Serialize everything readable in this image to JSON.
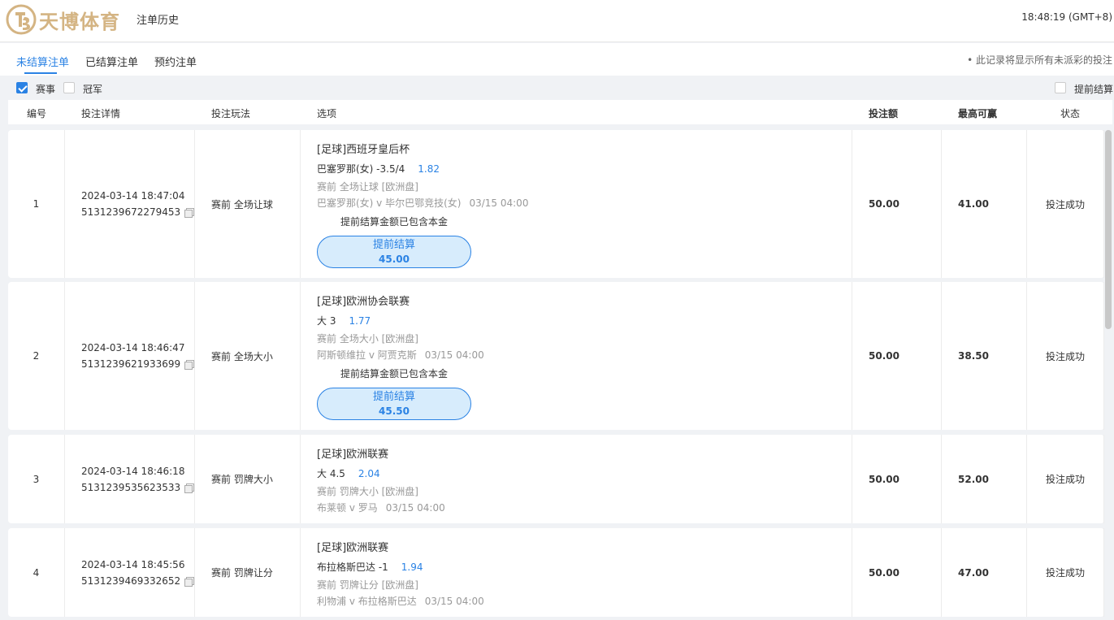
{
  "header": {
    "brand": "天博体育",
    "page_title": "注单历史",
    "clock": "18:48:19 (GMT+8)"
  },
  "tabs": [
    {
      "label": "未结算注单",
      "active": true
    },
    {
      "label": "已结算注单",
      "active": false
    },
    {
      "label": "预约注单",
      "active": false
    }
  ],
  "tab_note": "• 此记录将显示所有未派彩的投注",
  "filters": {
    "match_label": "赛事",
    "match_checked": true,
    "champion_label": "冠军",
    "champion_checked": false,
    "cashout_label": "提前结算",
    "cashout_checked": false
  },
  "columns": {
    "no": "编号",
    "detail": "投注详情",
    "play": "投注玩法",
    "option": "选项",
    "stake": "投注额",
    "max_win": "最高可赢",
    "status": "状态"
  },
  "bets": [
    {
      "no": "1",
      "time": "2024-03-14 18:47:04",
      "order_id": "5131239672279453",
      "play": "赛前 全场让球",
      "league": "[足球]西班牙皇后杯",
      "selection": "巴塞罗那(女) -3.5/4",
      "odds": "1.82",
      "market": "赛前   全场让球   [欧洲盘]",
      "match": "巴塞罗那(女) v 毕尔巴鄂竞技(女)",
      "match_date": "03/15 04:00",
      "cashout_note": "提前结算金额已包含本金",
      "cashout_label": "提前结算",
      "cashout_amount": "45.00",
      "stake": "50.00",
      "max_win": "41.00",
      "status": "投注成功"
    },
    {
      "no": "2",
      "time": "2024-03-14 18:46:47",
      "order_id": "5131239621933699",
      "play": "赛前 全场大小",
      "league": "[足球]欧洲协会联赛",
      "selection": "大 3",
      "odds": "1.77",
      "market": "赛前   全场大小   [欧洲盘]",
      "match": "阿斯顿维拉 v 阿贾克斯",
      "match_date": "03/15 04:00",
      "cashout_note": "提前结算金额已包含本金",
      "cashout_label": "提前结算",
      "cashout_amount": "45.50",
      "stake": "50.00",
      "max_win": "38.50",
      "status": "投注成功"
    },
    {
      "no": "3",
      "time": "2024-03-14 18:46:18",
      "order_id": "5131239535623533",
      "play": "赛前 罚牌大小",
      "league": "[足球]欧洲联赛",
      "selection": "大 4.5",
      "odds": "2.04",
      "market": "赛前   罚牌大小   [欧洲盘]",
      "match": "布莱顿 v 罗马",
      "match_date": "03/15 04:00",
      "stake": "50.00",
      "max_win": "52.00",
      "status": "投注成功"
    },
    {
      "no": "4",
      "time": "2024-03-14 18:45:56",
      "order_id": "5131239469332652",
      "play": "赛前 罚牌让分",
      "league": "[足球]欧洲联赛",
      "selection": "布拉格斯巴达 -1",
      "odds": "1.94",
      "market": "赛前   罚牌让分   [欧洲盘]",
      "match": "利物浦 v 布拉格斯巴达",
      "match_date": "03/15 04:00",
      "stake": "50.00",
      "max_win": "47.00",
      "status": "投注成功"
    }
  ]
}
